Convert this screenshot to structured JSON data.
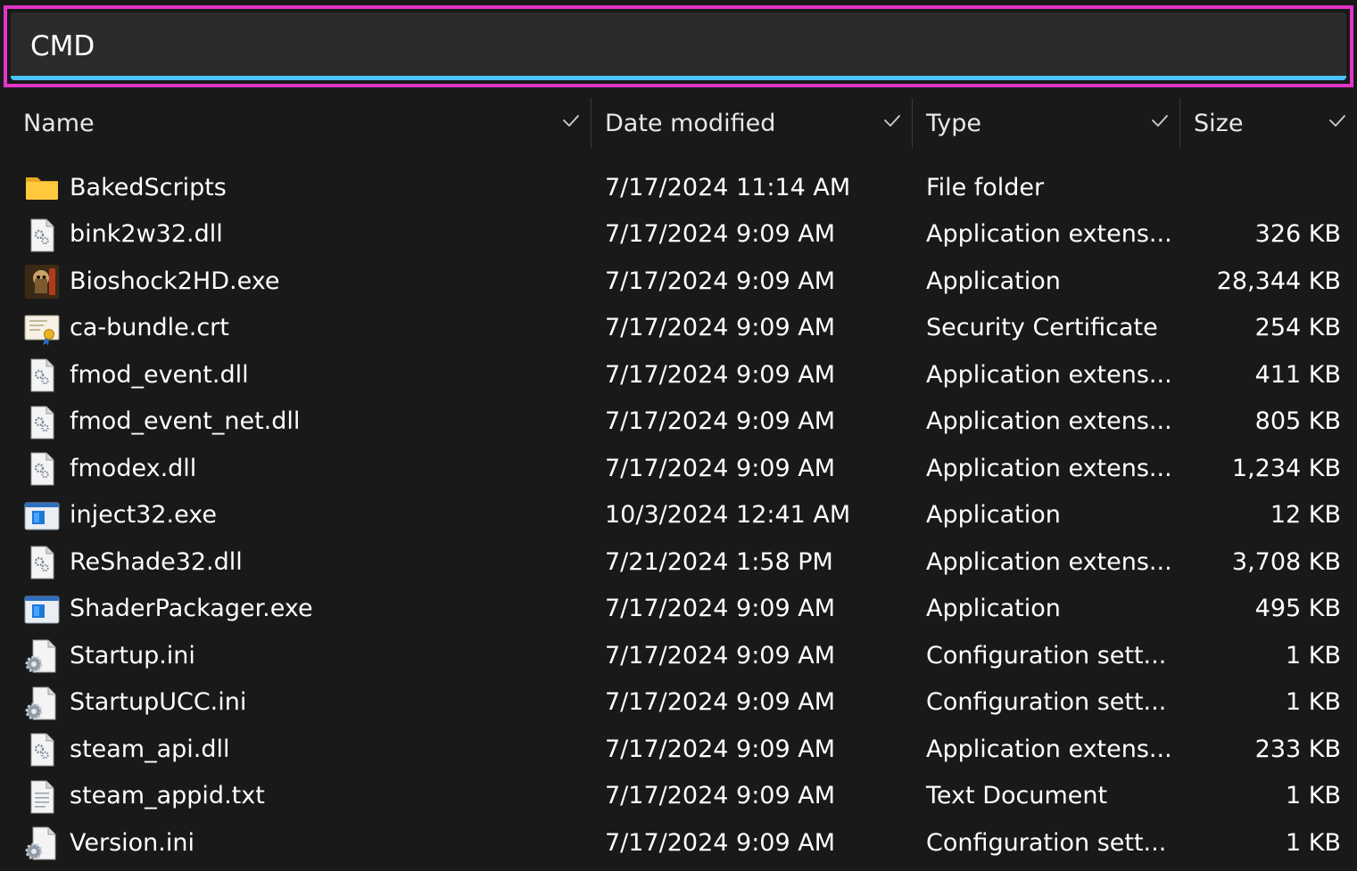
{
  "address_bar": {
    "value": "CMD"
  },
  "columns": {
    "name": "Name",
    "date": "Date modified",
    "type": "Type",
    "size": "Size"
  },
  "files": [
    {
      "name": "BakedScripts",
      "date": "7/17/2024 11:14 AM",
      "type": "File folder",
      "size": "",
      "icon": "folder-icon"
    },
    {
      "name": "bink2w32.dll",
      "date": "7/17/2024 9:09 AM",
      "type": "Application extens...",
      "size": "326 KB",
      "icon": "dll-icon"
    },
    {
      "name": "Bioshock2HD.exe",
      "date": "7/17/2024 9:09 AM",
      "type": "Application",
      "size": "28,344 KB",
      "icon": "game-exe-icon"
    },
    {
      "name": "ca-bundle.crt",
      "date": "7/17/2024 9:09 AM",
      "type": "Security Certificate",
      "size": "254 KB",
      "icon": "certificate-icon"
    },
    {
      "name": "fmod_event.dll",
      "date": "7/17/2024 9:09 AM",
      "type": "Application extens...",
      "size": "411 KB",
      "icon": "dll-icon"
    },
    {
      "name": "fmod_event_net.dll",
      "date": "7/17/2024 9:09 AM",
      "type": "Application extens...",
      "size": "805 KB",
      "icon": "dll-icon"
    },
    {
      "name": "fmodex.dll",
      "date": "7/17/2024 9:09 AM",
      "type": "Application extens...",
      "size": "1,234 KB",
      "icon": "dll-icon"
    },
    {
      "name": "inject32.exe",
      "date": "10/3/2024 12:41 AM",
      "type": "Application",
      "size": "12 KB",
      "icon": "exe-icon"
    },
    {
      "name": "ReShade32.dll",
      "date": "7/21/2024 1:58 PM",
      "type": "Application extens...",
      "size": "3,708 KB",
      "icon": "dll-icon"
    },
    {
      "name": "ShaderPackager.exe",
      "date": "7/17/2024 9:09 AM",
      "type": "Application",
      "size": "495 KB",
      "icon": "exe-icon"
    },
    {
      "name": "Startup.ini",
      "date": "7/17/2024 9:09 AM",
      "type": "Configuration sett...",
      "size": "1 KB",
      "icon": "config-icon"
    },
    {
      "name": "StartupUCC.ini",
      "date": "7/17/2024 9:09 AM",
      "type": "Configuration sett...",
      "size": "1 KB",
      "icon": "config-icon"
    },
    {
      "name": "steam_api.dll",
      "date": "7/17/2024 9:09 AM",
      "type": "Application extens...",
      "size": "233 KB",
      "icon": "dll-icon"
    },
    {
      "name": "steam_appid.txt",
      "date": "7/17/2024 9:09 AM",
      "type": "Text Document",
      "size": "1 KB",
      "icon": "text-file-icon"
    },
    {
      "name": "Version.ini",
      "date": "7/17/2024 9:09 AM",
      "type": "Configuration sett...",
      "size": "1 KB",
      "icon": "config-icon"
    }
  ],
  "colors": {
    "highlight_border": "#e234c8",
    "focus_underline": "#4cc2ff",
    "background": "#191919",
    "folder": "#ffc83d"
  }
}
